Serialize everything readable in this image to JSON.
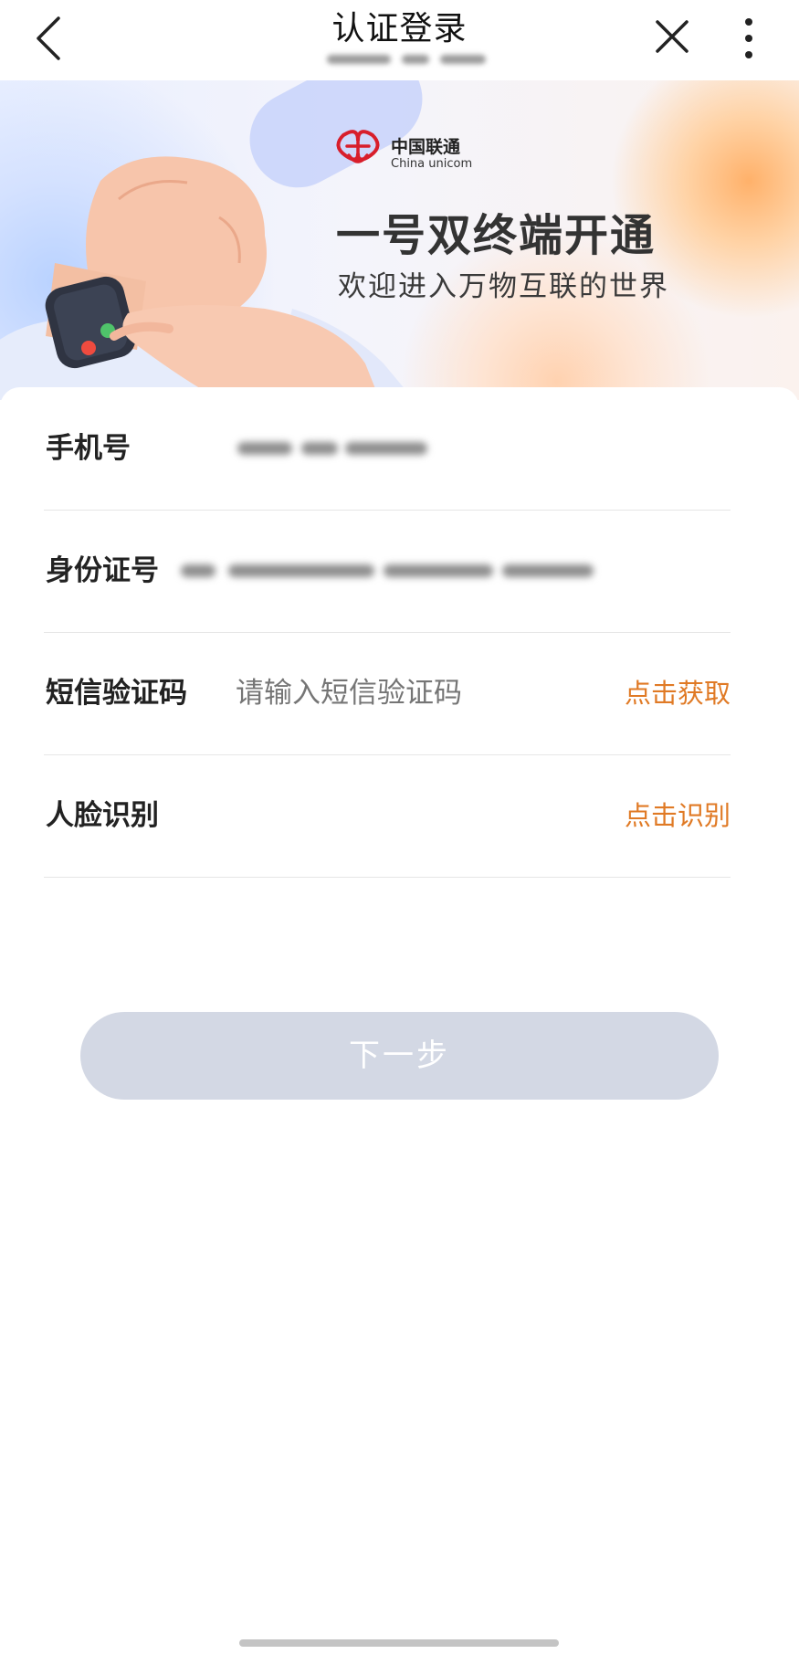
{
  "header": {
    "title": "认证登录"
  },
  "banner": {
    "brand_cn": "中国联通",
    "brand_en": "China unicom",
    "headline": "一号双终端开通",
    "subline": "欢迎进入万物互联的世界"
  },
  "form": {
    "phone": {
      "label": "手机号"
    },
    "id_number": {
      "label": "身份证号"
    },
    "sms_code": {
      "label": "短信验证码",
      "placeholder": "请输入短信验证码",
      "action": "点击获取"
    },
    "face": {
      "label": "人脸识别",
      "action": "点击识别"
    }
  },
  "next_button": {
    "label": "下一步"
  },
  "colors": {
    "accent": "#e07a25",
    "button_disabled": "#d3d8e4",
    "brand_red": "#d81e2b"
  },
  "icons": {
    "back": "chevron-left-icon",
    "close": "close-icon",
    "more": "more-vertical-icon",
    "logo": "china-unicom-knot-icon"
  }
}
